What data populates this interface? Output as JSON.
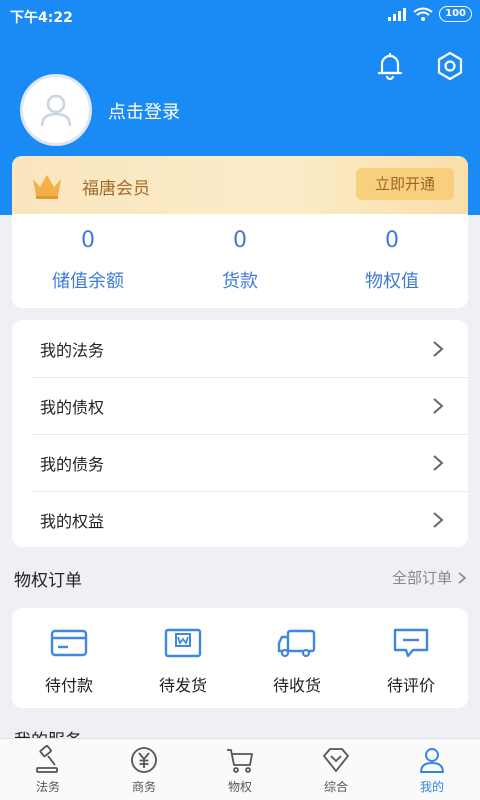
{
  "status_bar": {
    "time": "下午4:22",
    "battery": "100"
  },
  "profile": {
    "login_text": "点击登录"
  },
  "member": {
    "title": "福唐会员",
    "open_button": "立即开通",
    "stats": [
      {
        "value": "0",
        "label": "储值余额"
      },
      {
        "value": "0",
        "label": "货款"
      },
      {
        "value": "0",
        "label": "物权值"
      }
    ]
  },
  "menu": {
    "items": [
      {
        "label": "我的法务"
      },
      {
        "label": "我的债权"
      },
      {
        "label": "我的债务"
      },
      {
        "label": "我的权益"
      }
    ]
  },
  "orders": {
    "title": "物权订单",
    "all_link": "全部订单",
    "items": [
      {
        "label": "待付款",
        "icon": "card-icon"
      },
      {
        "label": "待发货",
        "icon": "package-icon"
      },
      {
        "label": "待收货",
        "icon": "truck-icon"
      },
      {
        "label": "待评价",
        "icon": "comment-icon"
      }
    ]
  },
  "services": {
    "title": "我的服务"
  },
  "tabbar": {
    "items": [
      {
        "label": "法务",
        "icon": "gavel-icon"
      },
      {
        "label": "商务",
        "icon": "yuan-icon"
      },
      {
        "label": "物权",
        "icon": "cart-icon"
      },
      {
        "label": "综合",
        "icon": "diamond-icon"
      },
      {
        "label": "我的",
        "icon": "user-icon"
      }
    ],
    "active": "我的"
  },
  "colors": {
    "header_blue": "#1a8af5",
    "accent_blue": "#3f7bd6",
    "gold": "#f8cf7d"
  }
}
